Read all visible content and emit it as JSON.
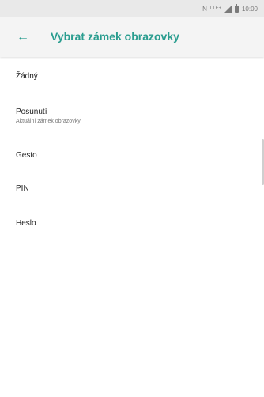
{
  "status_bar": {
    "nfc_icon": "N",
    "network_label": "LTE+",
    "time": "10:00"
  },
  "header": {
    "back_icon": "←",
    "title": "Vybrat zámek obrazovky"
  },
  "options": [
    {
      "title": "Žádný",
      "subtitle": ""
    },
    {
      "title": "Posunutí",
      "subtitle": "Aktuální zámek obrazovky"
    },
    {
      "title": "Gesto",
      "subtitle": ""
    },
    {
      "title": "PIN",
      "subtitle": ""
    },
    {
      "title": "Heslo",
      "subtitle": ""
    }
  ],
  "colors": {
    "accent": "#2a9d8f",
    "status_bar": "#e9e9e9"
  }
}
